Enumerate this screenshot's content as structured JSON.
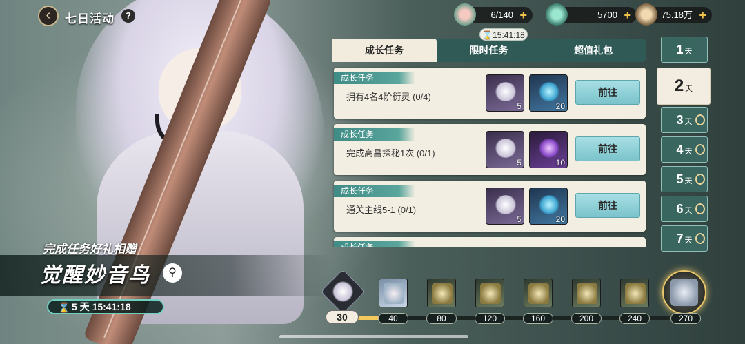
{
  "header": {
    "title": "七日活动",
    "help_icon": "?",
    "back_icon": "‹"
  },
  "resources": [
    {
      "icon": "peach-energy-icon",
      "value": "6/140"
    },
    {
      "icon": "jade-gem-icon",
      "value": "5700"
    },
    {
      "icon": "coin-icon",
      "value": "75.18万"
    }
  ],
  "tabs": [
    {
      "label": "成长任务",
      "active": true
    },
    {
      "label": "限时任务",
      "active": false
    },
    {
      "label": "超值礼包",
      "active": false
    }
  ],
  "tab_timer": "⌛15:41:18",
  "tasks": [
    {
      "tag": "成长任务",
      "desc": "拥有4名4阶衍灵 (0/4)",
      "rewards": [
        {
          "qty": "5"
        },
        {
          "qty": "20"
        }
      ],
      "button": "前往"
    },
    {
      "tag": "成长任务",
      "desc": "完成高昌探秘1次 (0/1)",
      "rewards": [
        {
          "qty": "5"
        },
        {
          "qty": "10"
        }
      ],
      "button": "前往"
    },
    {
      "tag": "成长任务",
      "desc": "通关主线5-1 (0/1)",
      "rewards": [
        {
          "qty": "5"
        },
        {
          "qty": "20"
        }
      ],
      "button": "前往"
    },
    {
      "tag": "成长任务",
      "desc": "",
      "rewards": [],
      "button": ""
    }
  ],
  "days": [
    {
      "num": "1",
      "unit": "天",
      "locked": false,
      "selected": false
    },
    {
      "num": "2",
      "unit": "天",
      "locked": false,
      "selected": true
    },
    {
      "num": "3",
      "unit": "天",
      "locked": true,
      "selected": false
    },
    {
      "num": "4",
      "unit": "天",
      "locked": true,
      "selected": false
    },
    {
      "num": "5",
      "unit": "天",
      "locked": true,
      "selected": false
    },
    {
      "num": "6",
      "unit": "天",
      "locked": true,
      "selected": false
    },
    {
      "num": "7",
      "unit": "天",
      "locked": true,
      "selected": false
    }
  ],
  "promo": {
    "subtitle": "完成任务好礼相赠",
    "title": "觉醒妙音鸟",
    "countdown": "5 天 15:41:18"
  },
  "progress": {
    "current": "30",
    "fraction": 0.11,
    "milestones": [
      "40",
      "80",
      "120",
      "160",
      "200",
      "240",
      "270"
    ]
  }
}
